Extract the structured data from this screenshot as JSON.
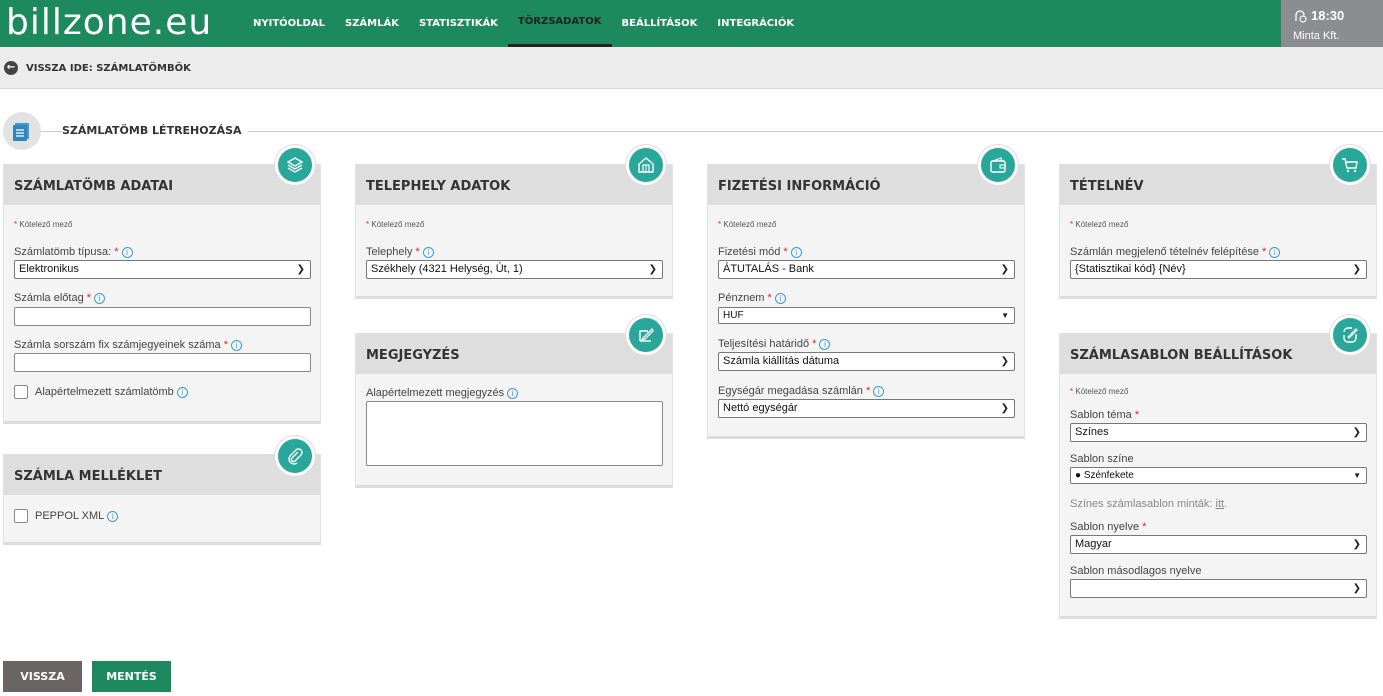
{
  "logo": "billzone.eu",
  "nav": [
    "NYITÓOLDAL",
    "SZÁMLÁK",
    "STATISZTIKÁK",
    "TÖRZSADATOK",
    "BEÁLLÍTÁSOK",
    "INTEGRÁCIÓK"
  ],
  "user": {
    "time": "18:30",
    "company": "Minta Kft."
  },
  "back_label": "VISSZA IDE: SZÁMLATÖMBÖK",
  "section_title": "SZÁMLATÖMB LÉTREHOZÁSA",
  "required_note": "Kötelező mező",
  "p1": {
    "title": "SZÁMLATÖMB ADATAI",
    "type_label": "Számlatömb típusa:",
    "type_value": "Elektronikus",
    "prefix_label": "Számla előtag",
    "prefix_value": "",
    "digits_label": "Számla sorszám fix számjegyeinek száma",
    "digits_value": "",
    "default_label": "Alapértelmezett számlatömb"
  },
  "p2": {
    "title": "SZÁMLA MELLÉKLET",
    "peppol_label": "PEPPOL XML"
  },
  "p3": {
    "title": "TELEPHELY ADATOK",
    "site_label": "Telephely",
    "site_value": "Székhely (4321 Helység, Út, 1)"
  },
  "p4": {
    "title": "MEGJEGYZÉS",
    "note_label": "Alapértelmezett megjegyzés",
    "note_value": ""
  },
  "p5": {
    "title": "FIZETÉSI INFORMÁCIÓ",
    "method_label": "Fizetési mód",
    "method_value": "ÁTUTALÁS - Bank",
    "currency_label": "Pénznem",
    "currency_value": "HUF",
    "deadline_label": "Teljesítési határidő",
    "deadline_value": "Számla kiállítás dátuma",
    "unit_label": "Egységár megadása számlán",
    "unit_value": "Nettó egységár"
  },
  "p6": {
    "title": "TÉTELNÉV",
    "struct_label": "Számlán megjelenő tételnév felépítése",
    "struct_value": "{Statisztikai kód} {Név}"
  },
  "p7": {
    "title": "SZÁMLASABLON BEÁLLÍTÁSOK",
    "theme_label": "Sablon téma",
    "theme_value": "Színes",
    "color_label": "Sablon színe",
    "color_value": "● Szénfekete",
    "samples_text": "Színes számlasablon minták:",
    "samples_link": "itt",
    "lang_label": "Sablon nyelve",
    "lang_value": "Magyar",
    "lang2_label": "Sablon másodlagos nyelve",
    "lang2_value": ""
  },
  "buttons": {
    "back": "VISSZA",
    "save": "MENTÉS"
  },
  "colors": {
    "brand": "#1c8a5e",
    "accent": "#2aa79b",
    "required": "#dd2233",
    "back_button": "#6b6464",
    "save_button": "#1c8a5e"
  }
}
